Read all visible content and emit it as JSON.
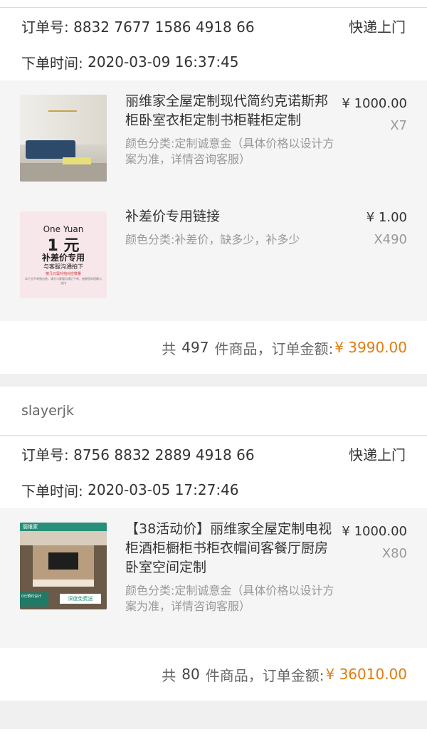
{
  "orders": [
    {
      "order_label": "订单号:",
      "order_no": "8832 7677 1586 4918 66",
      "delivery": "快递上门",
      "time_label": "下单时间:",
      "time": "2020-03-09 16:37:45",
      "items": [
        {
          "image": "living-room-photo",
          "title": "丽维家全屋定制现代简约克诺斯邦柜卧室衣柜定制书柜鞋柜定制",
          "spec": "颜色分类:定制诚意金（具体价格以设计方案为准，详情咨询客服）",
          "price": "¥ 1000.00",
          "qty": "X7"
        },
        {
          "image": "one-yuan-card",
          "image_text": {
            "l1": "One   Yuan",
            "l2": "1 元",
            "l3": "补差价专用",
            "l4": "与客服沟通拍下",
            "l5": "按几元需补拍对应数量",
            "l6": "本产品不单独出售，请先与客服沟通后下单，感谢您的理解与支持"
          },
          "title": "补差价专用链接",
          "spec": "颜色分类:补差价，缺多少，补多少",
          "price": "¥ 1.00",
          "qty": "X490"
        }
      ],
      "total_prefix": "共",
      "total_count": "497",
      "total_mid": "件商品，订单金额:",
      "total_amount": "¥ 3990.00"
    },
    {
      "shop": "slayerjk",
      "order_label": "订单号:",
      "order_no": "8756 8832 2889 4918 66",
      "delivery": "快递上门",
      "time_label": "下单时间:",
      "time": "2020-03-05 17:27:46",
      "items": [
        {
          "image": "tv-cabinet-photo",
          "image_text": {
            "brand": "丽维家",
            "badge": "0元预约设计",
            "tag": "深度免费送"
          },
          "title": "【38活动价】丽维家全屋定制电视柜酒柜橱柜书柜衣帽间客餐厅厨房卧室空间定制",
          "spec": "颜色分类:定制诚意金（具体价格以设计方案为准，详情咨询客服）",
          "price": "¥ 1000.00",
          "qty": "X80"
        }
      ],
      "total_prefix": "共",
      "total_count": "80",
      "total_mid": "件商品，订单金额:",
      "total_amount": "¥ 36010.00"
    }
  ],
  "colors": {
    "amount": "#e07d0f",
    "muted": "#999999",
    "item_bg": "#f5f5f5"
  }
}
